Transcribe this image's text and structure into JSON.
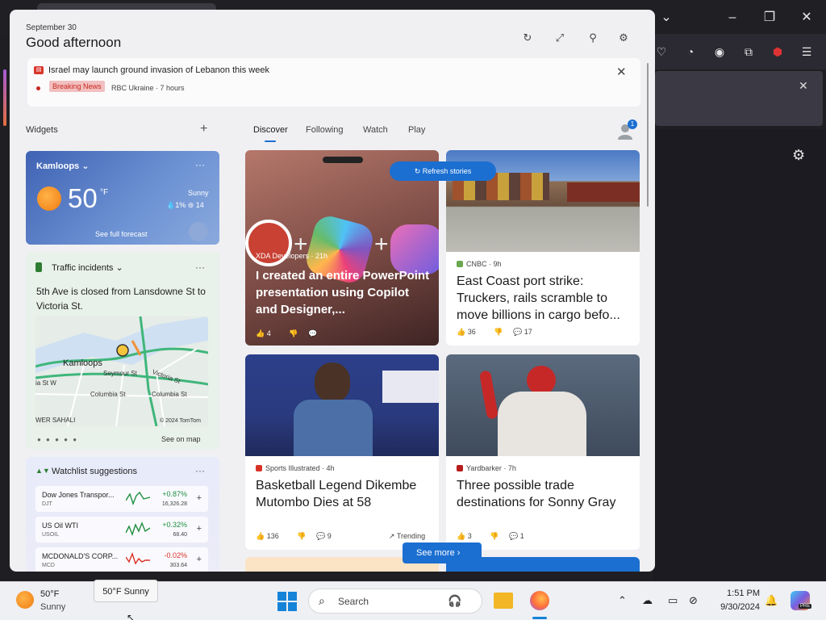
{
  "panel": {
    "date": "September 30",
    "greeting": "Good afternoon",
    "breaking": {
      "title": "Israel may launch ground invasion of Lebanon this week",
      "badge": "Breaking News",
      "source": "RBC Ukraine · 7 hours"
    },
    "widgets_label": "Widgets",
    "add_icon": "+"
  },
  "weather": {
    "city": "Kamloops",
    "temp": "50",
    "unit": "°F",
    "condition": "Sunny",
    "stats": "💧1%  ⊜ 14",
    "forecast_link": "See full forecast"
  },
  "traffic": {
    "title": "Traffic incidents",
    "description": "5th Ave is closed from Lansdowne St to Victoria St.",
    "map_labels": {
      "city": "Kamloops",
      "seymour": "Seymour St",
      "victoria": "Victoria St",
      "columbia1": "Columbia St",
      "columbia2": "Columbia St",
      "sahali": "WER SAHALI",
      "tomtom": "© 2024 TomTom",
      "edge": "ia St W"
    },
    "see_map": "See on map"
  },
  "watchlist": {
    "title": "Watchlist suggestions",
    "rows": [
      {
        "name": "Dow Jones Transpor...",
        "symbol": "DJT",
        "change": "+0.87%",
        "value": "16,326.28",
        "color": "#1e8e3e"
      },
      {
        "name": "US Oil WTI",
        "symbol": "USOIL",
        "change": "+0.32%",
        "value": "68.40",
        "color": "#1e8e3e"
      },
      {
        "name": "MCDONALD'S CORP...",
        "symbol": "MCD",
        "change": "-0.02%",
        "value": "303.64",
        "color": "#d93025"
      }
    ]
  },
  "feed": {
    "tabs": [
      "Discover",
      "Following",
      "Watch",
      "Play"
    ],
    "profile_badge": "1",
    "refresh": "Refresh stories",
    "see_more": "See more",
    "hero": {
      "source": "XDA Developers · 21h",
      "title": "I created an entire PowerPoint presentation using Copilot and Designer,...",
      "likes": "4"
    },
    "cards": [
      {
        "source": "CNBC · 9h",
        "title": "East Coast port strike: Truckers, rails scramble to move billions in cargo befo...",
        "likes": "36",
        "comments": "17",
        "trend": ""
      },
      {
        "source": "Sports Illustrated · 4h",
        "title": "Basketball Legend Dikembe Mutombo Dies at 58",
        "likes": "136",
        "comments": "9",
        "trend": "Trending"
      },
      {
        "source": "Yardbarker · 7h",
        "title": "Three possible trade destinations for Sonny Gray",
        "likes": "3",
        "comments": "1",
        "trend": ""
      }
    ]
  },
  "taskbar": {
    "temp": "50°F",
    "condition": "Sunny",
    "tooltip": "50°F Sunny",
    "search_placeholder": "Search",
    "time": "1:51 PM",
    "date": "9/30/2024",
    "copilot_tag": "PRE"
  },
  "colors": {
    "accent": "#1b6fd1",
    "breaking_red": "#c9281f"
  }
}
